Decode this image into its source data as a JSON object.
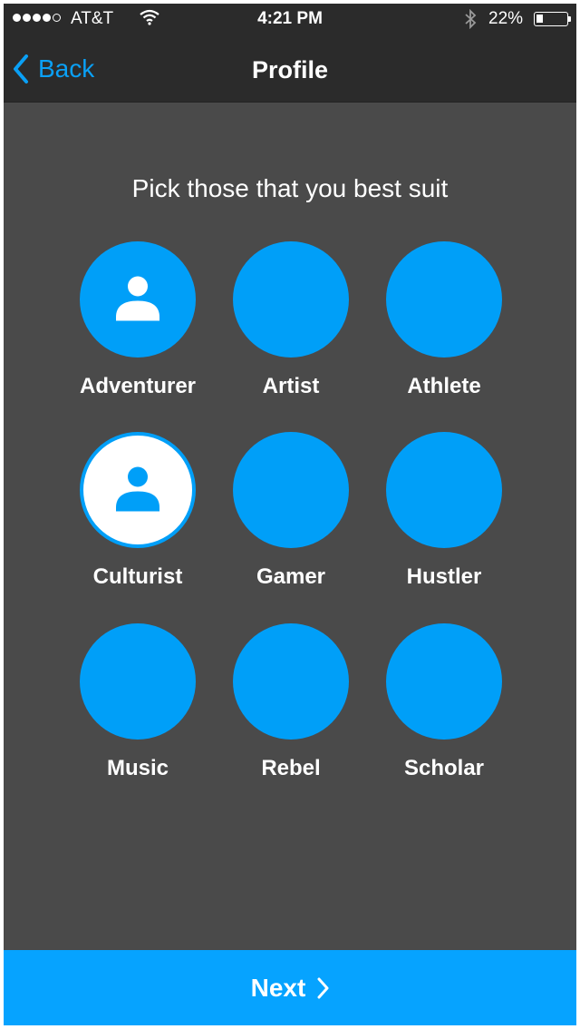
{
  "status_bar": {
    "carrier": "AT&T",
    "time": "4:21 PM",
    "battery_percent": "22%",
    "battery_level": 0.22,
    "signal_bars_filled": 4,
    "signal_bars_total": 5,
    "icons": [
      "wifi-icon",
      "bluetooth-icon",
      "battery-icon"
    ]
  },
  "nav": {
    "back_label": "Back",
    "title": "Profile"
  },
  "main": {
    "heading": "Pick those that you best suit",
    "options": [
      {
        "label": "Adventurer",
        "icon": "person-icon",
        "selected": false
      },
      {
        "label": "Artist",
        "icon": null,
        "selected": false
      },
      {
        "label": "Athlete",
        "icon": null,
        "selected": false
      },
      {
        "label": "Culturist",
        "icon": "person-icon",
        "selected": true
      },
      {
        "label": "Gamer",
        "icon": null,
        "selected": false
      },
      {
        "label": "Hustler",
        "icon": null,
        "selected": false
      },
      {
        "label": "Music",
        "icon": null,
        "selected": false
      },
      {
        "label": "Rebel",
        "icon": null,
        "selected": false
      },
      {
        "label": "Scholar",
        "icon": null,
        "selected": false
      }
    ]
  },
  "footer": {
    "next_label": "Next"
  },
  "colors": {
    "accent": "#009ff8",
    "next_button": "#06a3ff",
    "background": "#4a4a4a",
    "top_bar": "#2b2b2b",
    "selected_fill": "#ffffff"
  }
}
